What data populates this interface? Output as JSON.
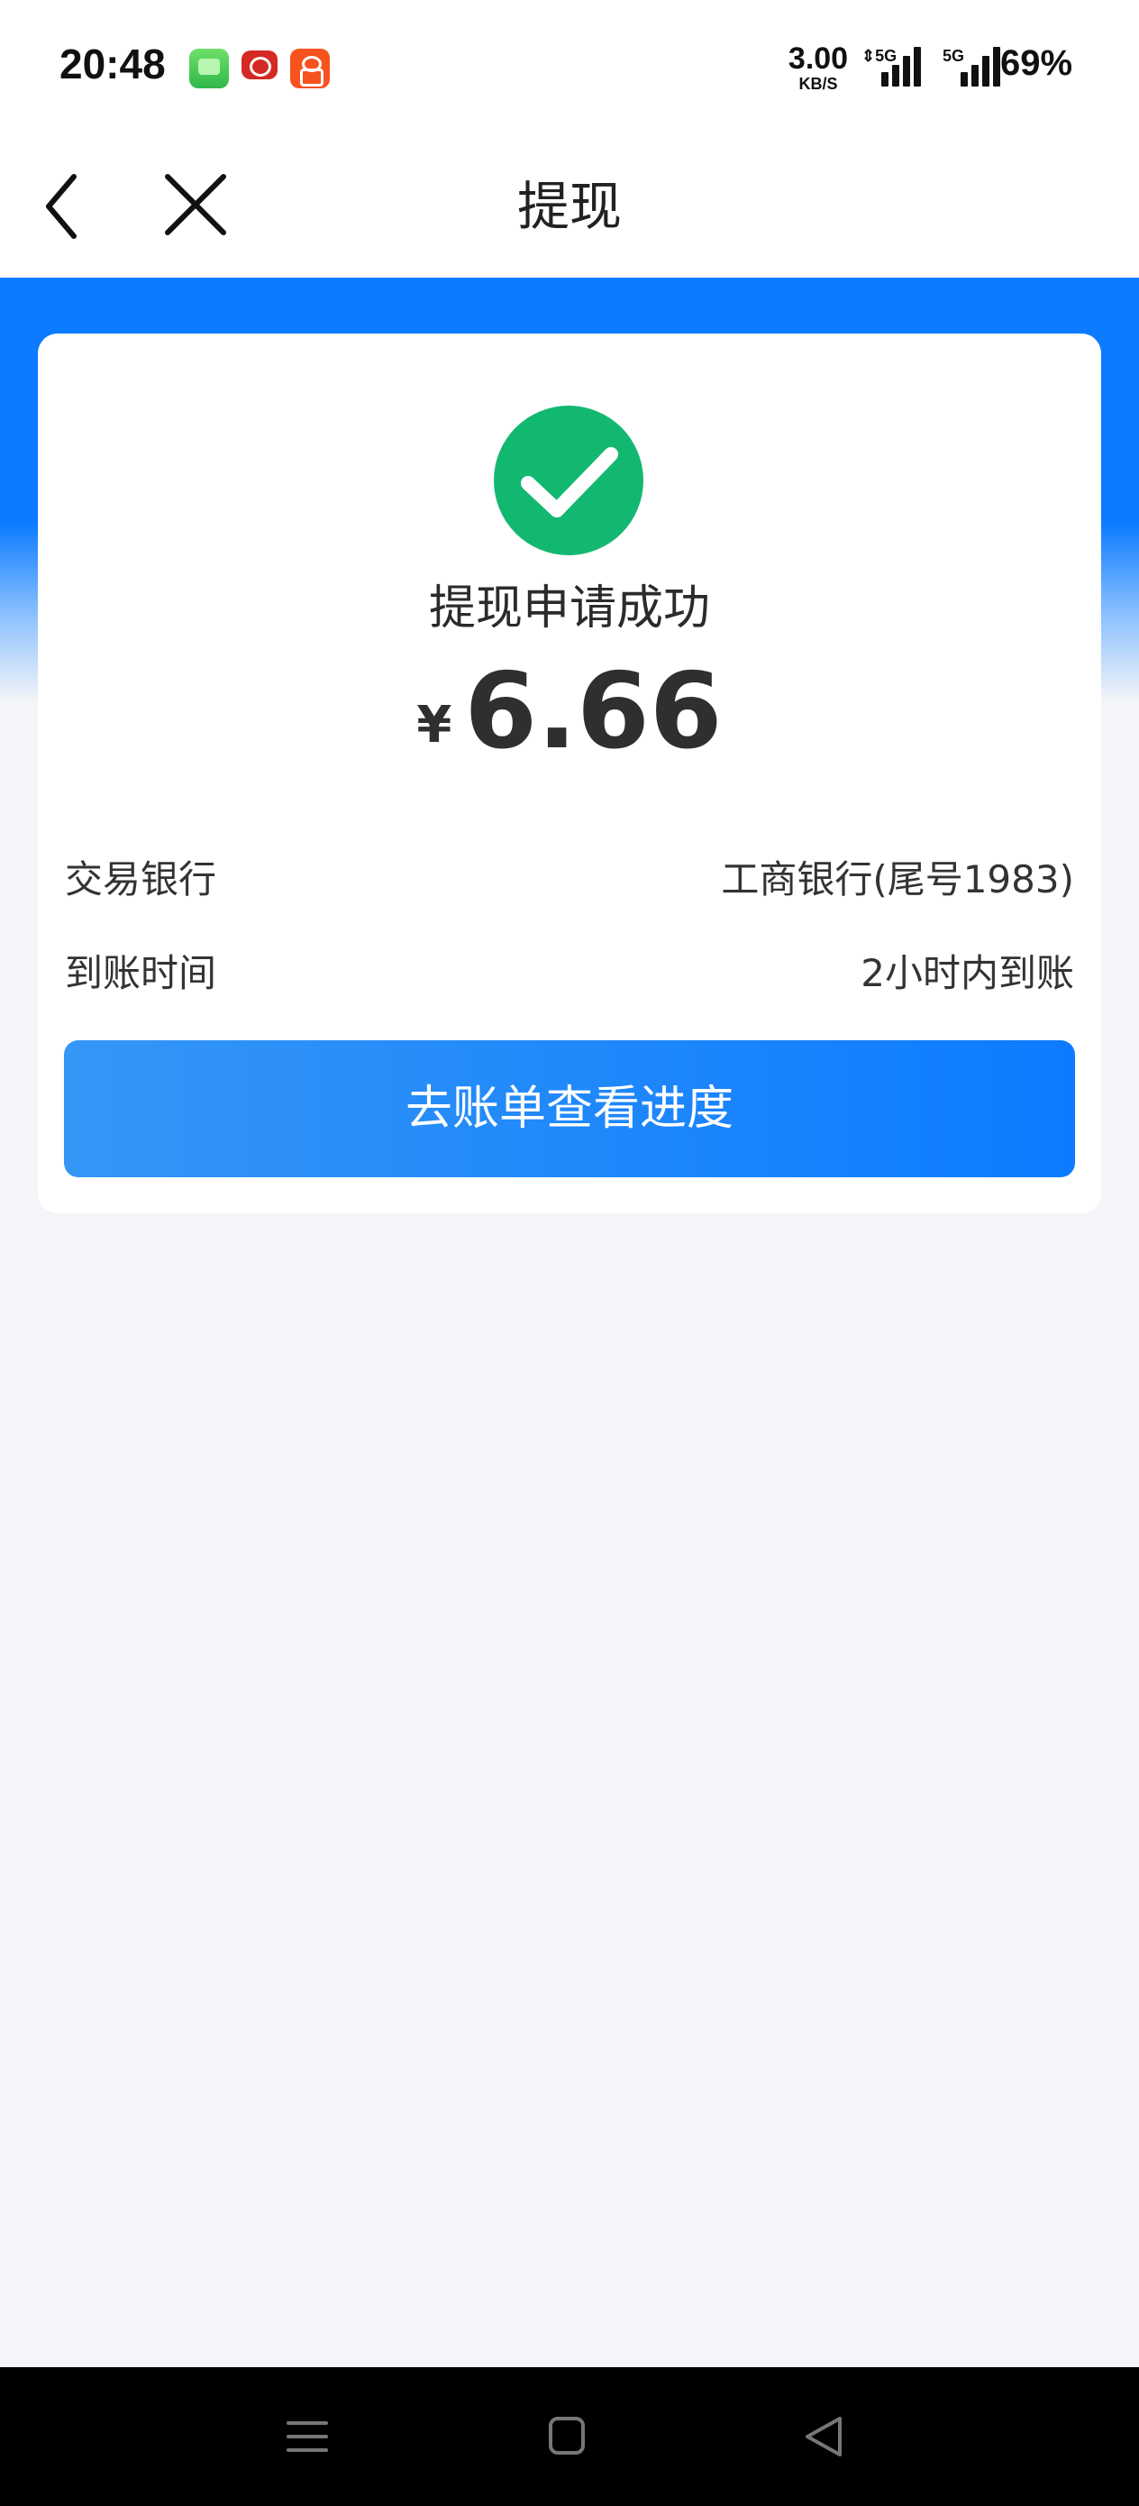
{
  "status_bar": {
    "time": "20:48",
    "network_speed_value": "3.00",
    "network_speed_unit": "KB/S",
    "signal_1_label": "⇕5G",
    "signal_2_label": "5G",
    "battery": "69%",
    "notification_icons": [
      "messages-app-icon",
      "china-post-icon",
      "orange-app-icon"
    ]
  },
  "nav": {
    "title": "提现",
    "back_icon": "chevron-left-icon",
    "close_icon": "close-icon"
  },
  "result": {
    "icon": "check-circle-icon",
    "icon_color": "#13b870",
    "title": "提现申请成功",
    "currency_symbol": "¥",
    "amount": "6.66"
  },
  "details": [
    {
      "label": "交易银行",
      "value": "工商银行(尾号1983)"
    },
    {
      "label": "到账时间",
      "value": "2小时内到账"
    }
  ],
  "action_button": {
    "label": "去账单查看进度",
    "color": "#0c7bff"
  },
  "system_nav": {
    "menu_icon": "menu-icon",
    "home_icon": "home-square-icon",
    "back_icon": "back-triangle-icon"
  },
  "theme": {
    "primary_blue": "#0c7bff",
    "page_background": "#f3f5f8"
  }
}
